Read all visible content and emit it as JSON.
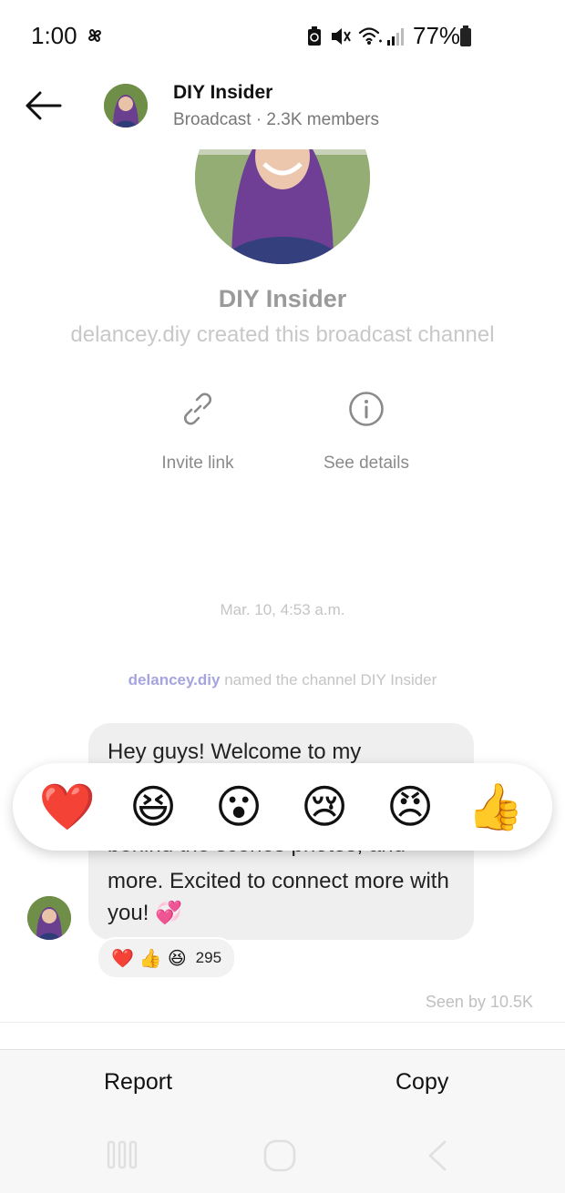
{
  "status_bar": {
    "time": "1:00",
    "battery_percent": "77%",
    "icons": [
      "pinwheel-icon",
      "battery-saver-icon",
      "mute-icon",
      "wifi-icon",
      "signal-icon",
      "battery-icon"
    ]
  },
  "header": {
    "title": "DIY Insider",
    "subtitle": "Broadcast · 2.3K members",
    "back_icon": "back-arrow-icon"
  },
  "profile": {
    "channel_name": "DIY Insider",
    "created_text": "delancey.diy created this broadcast channel"
  },
  "actions": [
    {
      "label": "Invite link",
      "icon": "link-icon"
    },
    {
      "label": "See details",
      "icon": "info-icon"
    }
  ],
  "conversation": {
    "timestamp": "Mar. 10, 4:53 a.m.",
    "named_user": "delancey.diy",
    "named_text": " named the channel DIY Insider",
    "message_top": "Hey guys! Welcome to my",
    "message_partial": "behind the scenes photos, and",
    "message_bottom": "more. Excited to connect more with you! 💞",
    "reaction_summary": {
      "emojis": [
        "❤️",
        "👍",
        "😆"
      ],
      "count": "295"
    },
    "seen_by": "Seen by 10.5K"
  },
  "reaction_bar": {
    "emojis": [
      "❤️",
      "😆",
      "😮",
      "😢",
      "😠",
      "👍"
    ]
  },
  "bottom_sheet": {
    "report_label": "Report",
    "copy_label": "Copy"
  },
  "colors": {
    "accent_username": "#a6a4dd",
    "bubble_bg": "#efefef",
    "heart_red": "#e0203a"
  }
}
